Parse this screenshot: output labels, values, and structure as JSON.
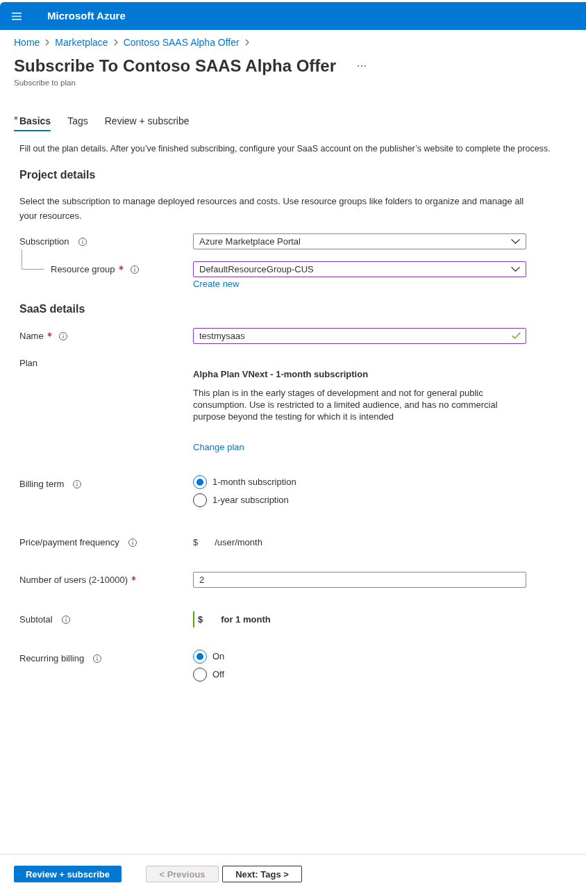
{
  "header": {
    "title": "Microsoft Azure"
  },
  "breadcrumb": [
    {
      "label": "Home"
    },
    {
      "label": "Marketplace"
    },
    {
      "label": "Contoso SAAS Alpha Offer"
    }
  ],
  "page": {
    "title": "Subscribe To Contoso SAAS Alpha Offer",
    "subtitle": "Subscribe to plan"
  },
  "tabs": [
    {
      "label": "Basics",
      "required": true,
      "selected": true
    },
    {
      "label": "Tags",
      "required": false,
      "selected": false
    },
    {
      "label": "Review + subscribe",
      "required": false,
      "selected": false
    }
  ],
  "intro": "Fill out the plan details. After you’ve finished subscribing, configure your SaaS account on the publisher’s website to complete the process.",
  "sections": [
    {
      "heading": "Project details",
      "description": "Select the subscription to manage deployed resources and costs. Use resource groups like folders to organize and manage all your resources.",
      "fields": [
        {
          "kind": "dropdown",
          "label": "Subscription",
          "required": false,
          "info": true,
          "nested": false,
          "value": "Azure Marketplace Portal",
          "highlighted": false
        },
        {
          "kind": "dropdown",
          "label": "Resource group",
          "required": true,
          "info": true,
          "nested": true,
          "value": "DefaultResourceGroup-CUS",
          "highlighted": true,
          "link": "Create new"
        }
      ]
    },
    {
      "heading": "SaaS details",
      "fields": [
        {
          "kind": "text",
          "label": "Name",
          "required": true,
          "info": true,
          "nested": false,
          "value": "testmysaas",
          "highlighted": true,
          "valid": true
        },
        {
          "kind": "plan",
          "label": "Plan",
          "required": false,
          "info": false,
          "nested": false,
          "title": "Alpha Plan VNext - 1-month subscription",
          "description": "This plan is in the early stages of development and not for general public consumption. Use is restricted to a limited audience, and has no commercial purpose beyond the testing for which it is intended",
          "link": "Change plan"
        },
        {
          "kind": "radio",
          "label": "Billing term",
          "required": false,
          "info": true,
          "nested": false,
          "options": [
            {
              "label": "1-month subscription",
              "selected": true
            },
            {
              "label": "1-year subscription",
              "selected": false
            }
          ]
        },
        {
          "kind": "price",
          "label": "Price/payment frequency",
          "required": false,
          "info": true,
          "nested": false,
          "currency": "$",
          "unit": "/user/month"
        },
        {
          "kind": "text",
          "label": "Number of users (2-10000)",
          "required": true,
          "info": false,
          "nested": false,
          "value": "2",
          "highlighted": false,
          "valid": false
        },
        {
          "kind": "subtotal",
          "label": "Subtotal",
          "required": false,
          "info": true,
          "nested": false,
          "currency": "$",
          "period": "for 1 month"
        },
        {
          "kind": "radio",
          "label": "Recurring billing",
          "required": false,
          "info": true,
          "nested": false,
          "options": [
            {
              "label": "On",
              "selected": true
            },
            {
              "label": "Off",
              "selected": false
            }
          ]
        }
      ]
    }
  ],
  "footer": {
    "buttons": [
      {
        "label": "Review + subscribe",
        "kind": "primary",
        "disabled": false
      },
      {
        "label": "< Previous",
        "kind": "secondary",
        "disabled": true
      },
      {
        "label": "Next: Tags >",
        "kind": "secondary",
        "disabled": false
      }
    ]
  }
}
